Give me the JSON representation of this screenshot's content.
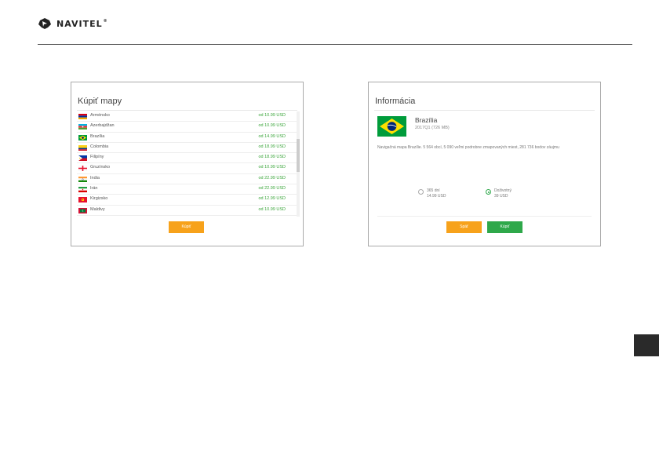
{
  "header": {
    "brand": "NAVITEL",
    "registered_mark": "®"
  },
  "buy_maps": {
    "title": "Kúpiť mapy",
    "items": [
      {
        "name": "Arménsko",
        "price": "od 10.99 USD",
        "flag": "armenia-flag-icon"
      },
      {
        "name": "Azerbajdžan",
        "price": "od 10.99 USD",
        "flag": "azerbaijan-flag-icon"
      },
      {
        "name": "Brazília",
        "price": "od 14.99 USD",
        "flag": "brazil-flag-icon"
      },
      {
        "name": "Colombia",
        "price": "od 18.99 USD",
        "flag": "colombia-flag-icon"
      },
      {
        "name": "Filipíny",
        "price": "od 18.99 USD",
        "flag": "philippines-flag-icon"
      },
      {
        "name": "Gruzínsko",
        "price": "od 10.99 USD",
        "flag": "georgia-flag-icon"
      },
      {
        "name": "India",
        "price": "od 22.99 USD",
        "flag": "india-flag-icon"
      },
      {
        "name": "Irán",
        "price": "od 22.99 USD",
        "flag": "iran-flag-icon"
      },
      {
        "name": "Kirgizsko",
        "price": "od 12.99 USD",
        "flag": "kyrgyzstan-flag-icon"
      },
      {
        "name": "Maldivy",
        "price": "od 10.99 USD",
        "flag": "maldives-flag-icon"
      }
    ],
    "buy_button": "Kúpiť"
  },
  "info": {
    "title": "Informácia",
    "country": "Brazília",
    "version": "2017Q1 (726 MB)",
    "description": "Navigačná mapa Brazílie. 5 564 obcí, 5 090 veľmi podrobne zmapovaných miest, 281 736 bodov záujmu",
    "options": [
      {
        "line1": "365 dní",
        "line2": "14.99 USD",
        "selected": false
      },
      {
        "line1": "Doživotný",
        "line2": "39 USD",
        "selected": true
      }
    ],
    "back_button": "Späť",
    "buy_button": "Kúpiť"
  },
  "colors": {
    "price_green": "#3aa53a",
    "button_orange": "#f7a21b",
    "button_green": "#2ea84a",
    "page_tab": "#2a2a2a"
  }
}
